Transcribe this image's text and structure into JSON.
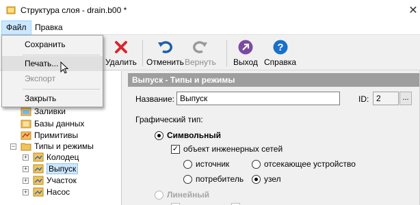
{
  "window": {
    "title": "Структура слоя - drain.b00 *",
    "close_glyph": "✕"
  },
  "menubar": {
    "file": "Файл",
    "help": "Правка"
  },
  "file_menu": {
    "items": [
      {
        "label": "Сохранить",
        "enabled": true
      },
      {
        "label": "Печать...",
        "enabled": true,
        "hovered": true
      },
      {
        "label": "Экспорт",
        "enabled": false
      },
      {
        "label": "Закрыть",
        "enabled": true
      }
    ]
  },
  "toolbar": {
    "delete": "Удалить",
    "undo": "Отменить",
    "redo": "Вернуть",
    "exit": "Выход",
    "help": "Справка"
  },
  "tree": {
    "items": [
      {
        "label": "Заливки",
        "icon": "fill-folder-icon"
      },
      {
        "label": "Базы данных",
        "icon": "database-folder-icon"
      },
      {
        "label": "Примитивы",
        "icon": "primitives-folder-icon"
      },
      {
        "label": "Типы и режимы",
        "icon": "folder-open-icon",
        "expanded": true
      },
      {
        "label": "Колодец",
        "icon": "mode-icon"
      },
      {
        "label": "Выпуск",
        "icon": "mode-icon",
        "selected": true
      },
      {
        "label": "Участок",
        "icon": "mode-icon"
      },
      {
        "label": "Насос",
        "icon": "mode-icon"
      }
    ]
  },
  "panel": {
    "header": "Выпуск - Типы и режимы",
    "name_label": "Название:",
    "name_value": "Выпуск",
    "id_label": "ID:",
    "id_value": "2",
    "id_button": "...",
    "graphic_type_label": "Графический тип:",
    "symbolic_label": "Символьный",
    "symbolic_selected": true,
    "eng_networks_label": "объект инженерных сетей",
    "eng_networks_checked": true,
    "source_label": "источник",
    "cutoff_label": "отсекающее устройство",
    "consumer_label": "потребитель",
    "node_label": "узел",
    "node_selected": true,
    "linear_label": "Линейный"
  },
  "colors": {
    "header_bg": "#9e9e9e",
    "selection": "#cce8ff",
    "delete_red": "#d9262c",
    "undo_blue": "#1d5fa8",
    "exit_purple": "#7b4aa0",
    "help_blue": "#1a6fc9"
  }
}
